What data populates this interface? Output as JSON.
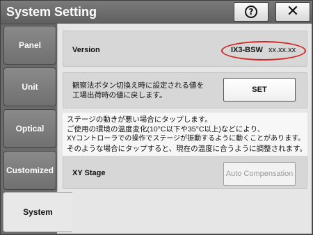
{
  "window": {
    "title": "System Setting",
    "help_icon": "question-circle-icon",
    "close_icon": "close-icon"
  },
  "sidebar": {
    "items": [
      {
        "label": "Panel",
        "active": false
      },
      {
        "label": "Unit",
        "active": false
      },
      {
        "label": "Optical",
        "active": false
      },
      {
        "label": "Customized",
        "active": false
      },
      {
        "label": "System",
        "active": true
      }
    ]
  },
  "version": {
    "label": "Version",
    "product": "IX3-BSW",
    "number": "xx.xx.xx",
    "highlight_color": "#d42424"
  },
  "reset": {
    "text_line1": "観察法ボタン切換え時に設定される値を",
    "text_line2": "工場出荷時の値に戻します。",
    "button_label": "SET"
  },
  "xy_stage": {
    "info_lines": [
      "ステージの動きが悪い場合にタップします。",
      "ご使用の環境の温度変化(10°C以下や35°C以上)などにより、",
      "XYコントローラでの操作でステージが振動するように動くことがあります。",
      "そのような場合にタップすると、現在の温度に合うように調整されます。"
    ],
    "label": "XY Stage",
    "button_label": "Auto Compensation",
    "button_disabled": true
  }
}
